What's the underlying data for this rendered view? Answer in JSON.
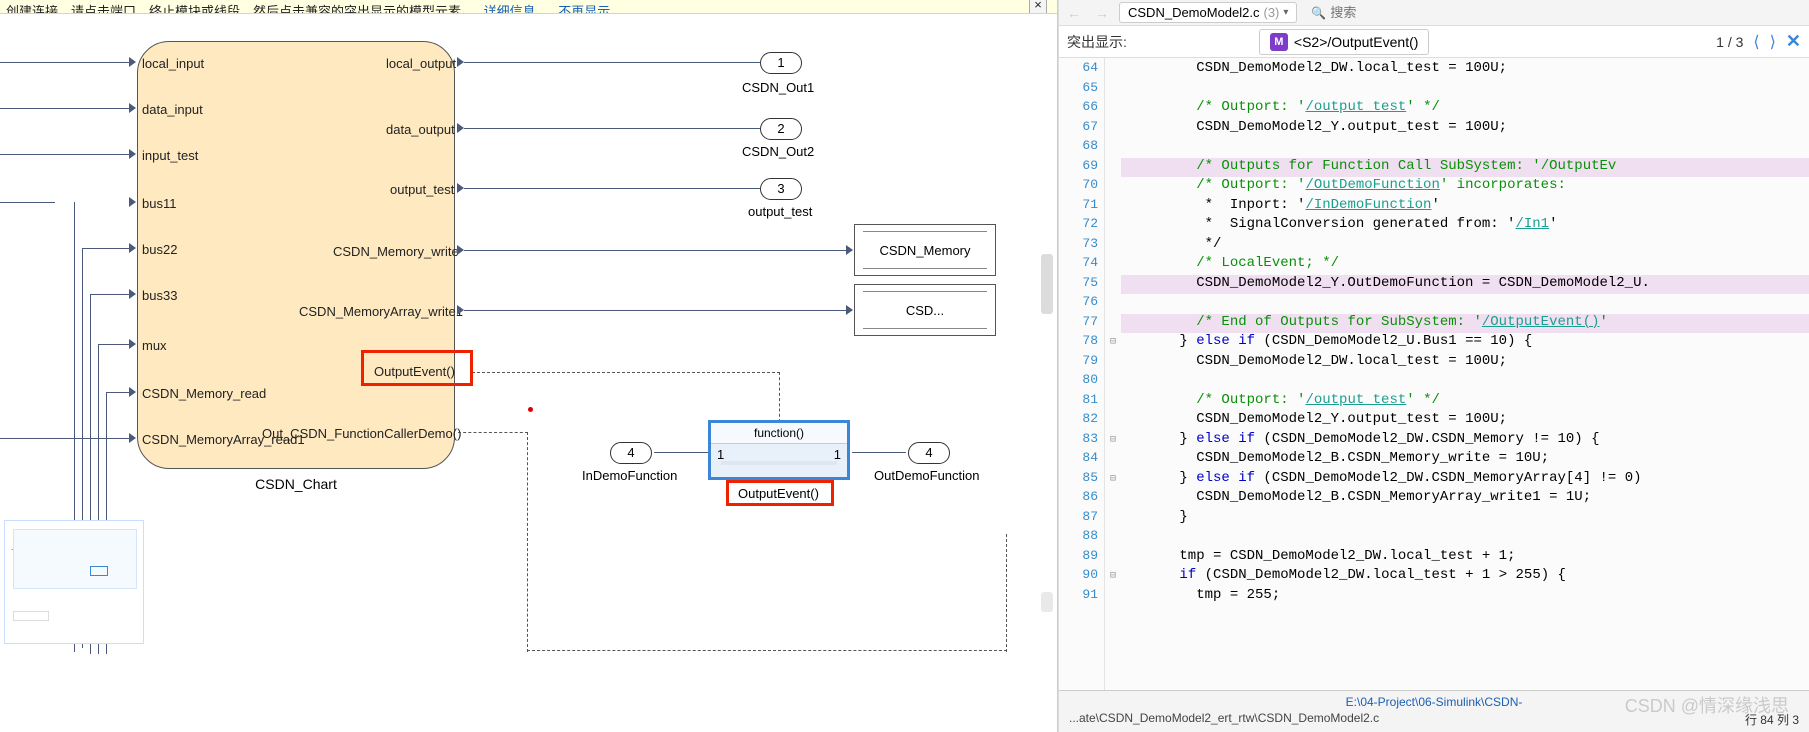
{
  "hint": {
    "text": "创建连接，请点击端口、终止模块或线段，然后点击兼容的突出显示的模型元素。",
    "link1": "详细信息。",
    "link2": "不再显示"
  },
  "chart": {
    "title": "CSDN_Chart",
    "inputs": [
      "local_input",
      "data_input",
      "input_test",
      "bus11",
      "bus22",
      "bus33",
      "mux",
      "CSDN_Memory_read",
      "CSDN_MemoryArray_read1"
    ],
    "outputs": [
      "local_output",
      "data_output",
      "output_test",
      "CSDN_Memory_write",
      "CSDN_MemoryArray_write1",
      "OutputEvent()",
      "Out_CSDN_FunctionCallerDemo()"
    ]
  },
  "outports": {
    "o1": {
      "num": "1",
      "label": "CSDN_Out1"
    },
    "o2": {
      "num": "2",
      "label": "CSDN_Out2"
    },
    "o3": {
      "num": "3",
      "label": "output_test"
    },
    "m1": "CSDN_Memory",
    "m2": "CSD...",
    "f_in": {
      "num": "4",
      "label": "InDemoFunction"
    },
    "f_out": {
      "num": "4",
      "label": "OutDemoFunction"
    }
  },
  "func": {
    "top": "function()",
    "l": "1",
    "r": "1",
    "bottom": "OutputEvent()"
  },
  "code": {
    "file": "CSDN_DemoModel2.c",
    "file_count": "(3)",
    "search_ph": "搜索",
    "hl_label": "突出显示:",
    "hl_text": "<S2>/OutputEvent()",
    "hl_count": "1 / 3",
    "lines": {
      "64": "        CSDN_DemoModel2_DW.local_test = 100U;",
      "65": "",
      "66": "        /* Outport: '<Root>/output_test' */",
      "67": "        CSDN_DemoModel2_Y.output_test = 100U;",
      "68": "",
      "69": "        /* Outputs for Function Call SubSystem: '<S2>/OutputEv",
      "70": "        /* Outport: '<Root>/OutDemoFunction' incorporates:",
      "71": "         *  Inport: '<Root>/InDemoFunction'",
      "72": "         *  SignalConversion generated from: '<S5>/In1'",
      "73": "         */",
      "74": "        /* LocalEvent; */",
      "75": "        CSDN_DemoModel2_Y.OutDemoFunction = CSDN_DemoModel2_U.",
      "76": "",
      "77": "        /* End of Outputs for SubSystem: '<S2>/OutputEvent()'",
      "78": "      } else if (CSDN_DemoModel2_U.Bus1 == 10) {",
      "79": "        CSDN_DemoModel2_DW.local_test = 100U;",
      "80": "",
      "81": "        /* Outport: '<Root>/output_test' */",
      "82": "        CSDN_DemoModel2_Y.output_test = 100U;",
      "83": "      } else if (CSDN_DemoModel2_DW.CSDN_Memory != 10) {",
      "84": "        CSDN_DemoModel2_B.CSDN_Memory_write = 10U;",
      "85": "      } else if (CSDN_DemoModel2_DW.CSDN_MemoryArray[4] != 0)",
      "86": "        CSDN_DemoModel2_B.CSDN_MemoryArray_write1 = 1U;",
      "87": "      }",
      "88": "",
      "89": "      tmp = CSDN_DemoModel2_DW.local_test + 1;",
      "90": "      if (CSDN_DemoModel2_DW.local_test + 1 > 255) {",
      "91": "        tmp = 255;"
    },
    "status1": "E:\\04-Project\\06-Simulink\\CSDN-",
    "status2": "...ate\\CSDN_DemoModel2_ert_rtw\\CSDN_DemoModel2.c",
    "status_rc": "行   84       列    3"
  },
  "watermark": "CSDN @情深缘浅思"
}
